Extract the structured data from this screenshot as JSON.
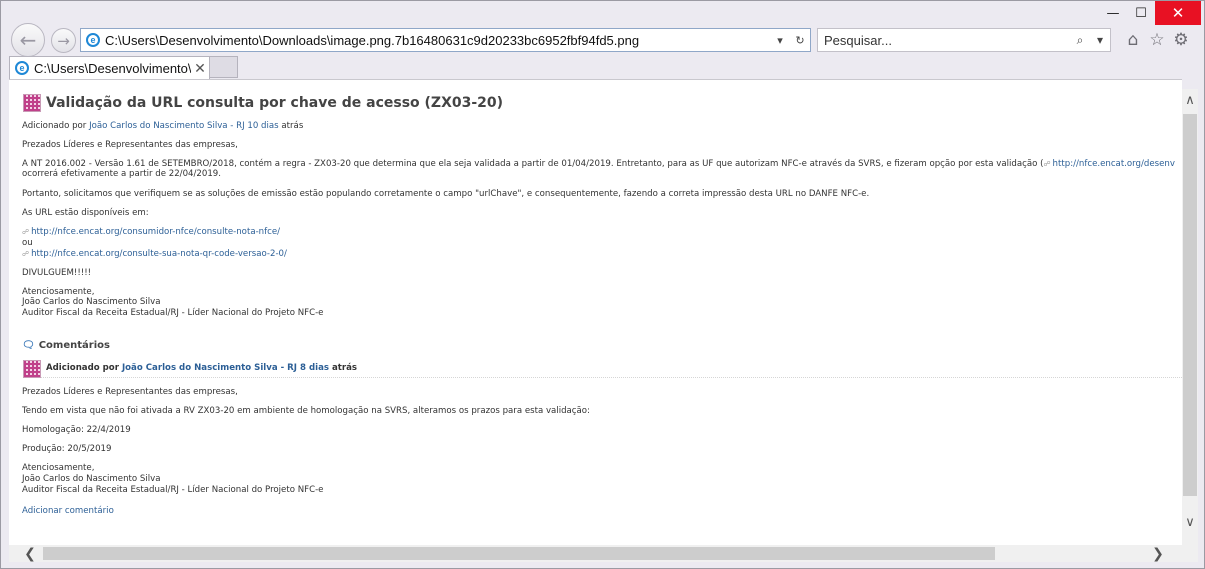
{
  "window": {
    "minimize": "—",
    "maximize": "☐",
    "close": "✕"
  },
  "toolbar": {
    "back": "←",
    "forward": "→",
    "address": "C:\\Users\\Desenvolvimento\\Downloads\\image.png.7b16480631c9d20233bc6952fbf94fd5.png",
    "address_dropdown": "▾",
    "refresh": "↻",
    "search_placeholder": "Pesquisar...",
    "search_icon": "⌕",
    "search_dropdown": "▾",
    "home": "⌂",
    "favorites": "☆",
    "settings": "⚙"
  },
  "tab": {
    "label": "C:\\Users\\Desenvolvimento\\...",
    "close": "✕",
    "icon": "e"
  },
  "post": {
    "title": "Validação da URL consulta por chave de acesso (ZX03-20)",
    "added_by_prefix": "Adicionado por",
    "author": "João Carlos do Nascimento Silva - RJ",
    "time": "10 dias",
    "time_suffix": "atrás",
    "greeting": "Prezados Líderes e Representantes das empresas,",
    "para1_text": "A NT 2016.002 - Versão 1.61 de SETEMBRO/2018, contém a regra - ZX03-20 que determina que ela seja validada a partir de 01/04/2019. Entretanto, para as UF que autorizam NFC-e através da SVRS, e fizeram opção por esta validação (",
    "para1_link": "http://nfce.encat.org/desenv",
    "para1_line2": "ocorrerá efetivamente a partir de 22/04/2019.",
    "para2": "Portanto, solicitamos que verifiquem se as soluções de emissão estão populando corretamente o campo \"urlChave\", e consequentemente, fazendo a correta impressão desta URL no DANFE NFC-e.",
    "para3": "As URL estão disponíveis em:",
    "link1": "http://nfce.encat.org/consumidor-nfce/consulte-nota-nfce/",
    "or": "ou",
    "link2": "http://nfce.encat.org/consulte-sua-nota-qr-code-versao-2-0/",
    "shout": "DIVULGUEM!!!!!",
    "sign1": "Atenciosamente,",
    "sign2": "João Carlos do Nascimento Silva",
    "sign3": "Auditor Fiscal da Receita Estadual/RJ - Líder Nacional do Projeto NFC-e"
  },
  "comments": {
    "heading": "Comentários",
    "items": [
      {
        "added_by_prefix": "Adicionado por",
        "author": "João Carlos do Nascimento Silva - RJ",
        "time": "8 dias",
        "time_suffix": "atrás",
        "greeting": "Prezados Líderes e Representantes das empresas,",
        "para1": "Tendo em vista que não foi ativada a RV ZX03-20 em ambiente de homologação na SVRS, alteramos os prazos para esta validação:",
        "homolog": "Homologação: 22/4/2019",
        "producao": "Produção: 20/5/2019",
        "sign1": "Atenciosamente,",
        "sign2": "João Carlos do Nascimento Silva",
        "sign3": "Auditor Fiscal da Receita Estadual/RJ - Líder Nacional do Projeto NFC-e"
      }
    ],
    "add_link": "Adicionar comentário"
  },
  "scrollbars": {
    "up": "∧",
    "down": "∨",
    "left": "❮",
    "right": "❯"
  }
}
